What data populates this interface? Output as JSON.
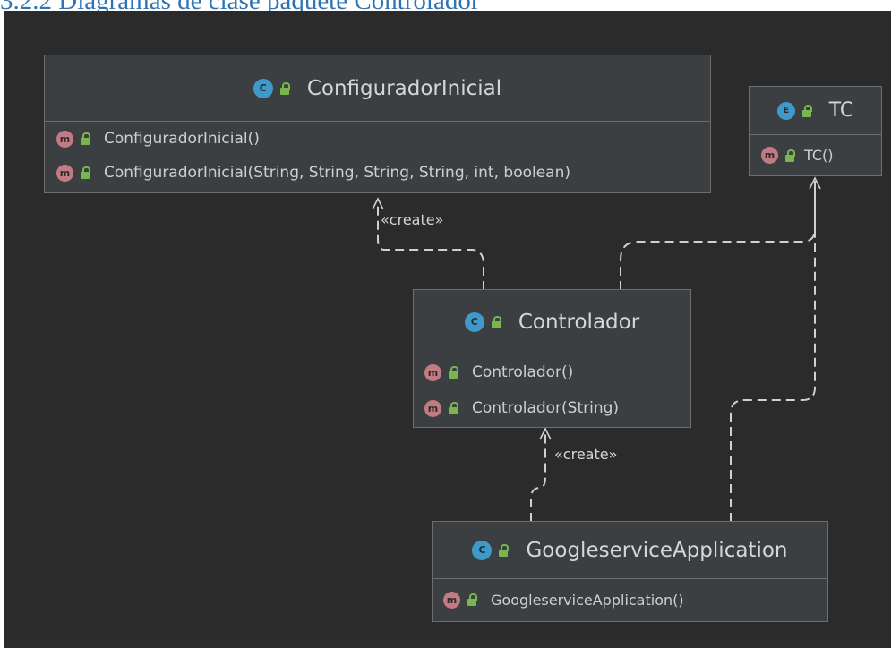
{
  "heading": "3.2.2 Diagramas de clase paquete Controlador",
  "colors": {
    "background": "#2b2b2b",
    "box": "#3c3f41",
    "border": "#6e6e6e",
    "text": "#d6d6d6",
    "method_badge": "#c27a83",
    "class_badge": "#3e9acb",
    "visibility": "#7ab650",
    "line": "#d0d0d0"
  },
  "classes": {
    "configurador": {
      "name": "ConfiguradorInicial",
      "badge": "C",
      "badge_icon": "class-icon",
      "methods": [
        "ConfiguradorInicial()",
        "ConfiguradorInicial(String, String, String, String, int, boolean)"
      ]
    },
    "tc": {
      "name": "TC",
      "badge": "E",
      "badge_icon": "enum-icon",
      "methods": [
        "TC()"
      ]
    },
    "controlador": {
      "name": "Controlador",
      "badge": "C",
      "badge_icon": "runnable-class-icon",
      "methods": [
        "Controlador()",
        "Controlador(String)"
      ]
    },
    "googleservice": {
      "name": "GoogleserviceApplication",
      "badge": "C",
      "badge_icon": "spring-boot-class-icon",
      "methods": [
        "GoogleserviceApplication()"
      ]
    }
  },
  "method_badge": "m",
  "relations": {
    "create_label_1": "«create»",
    "create_label_2": "«create»"
  }
}
